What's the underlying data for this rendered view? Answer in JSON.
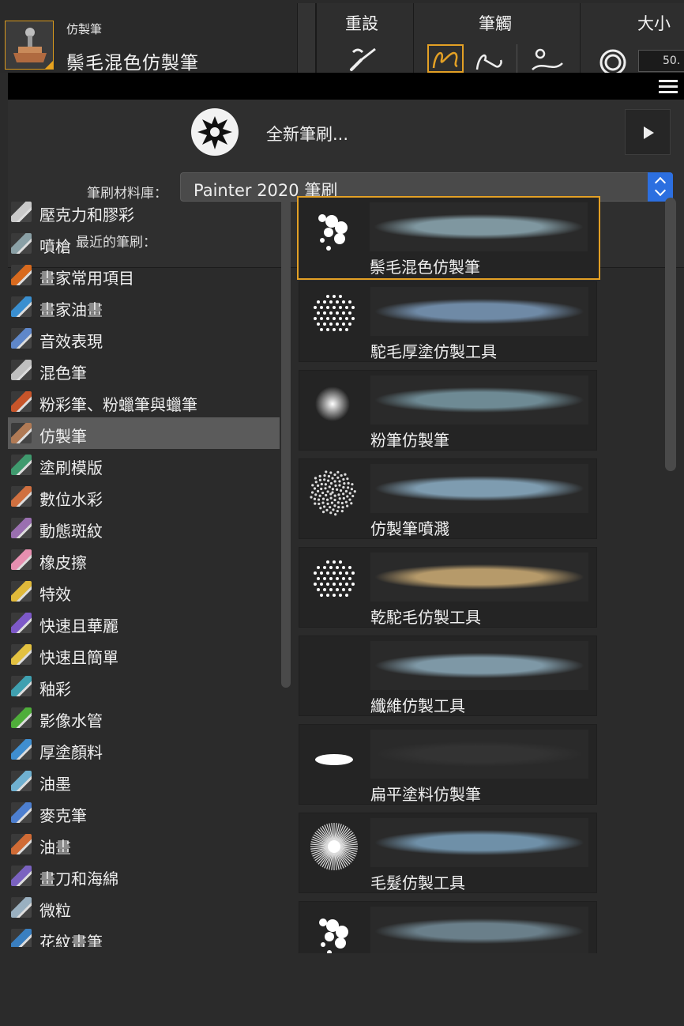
{
  "toolbar": {
    "category": "仿製筆",
    "variant": "鬃毛混色仿製筆",
    "reset_label": "重設",
    "dab_label": "筆觸",
    "size_label": "大小",
    "size_value": "50."
  },
  "panel": {
    "new_brush_label": "全新筆刷...",
    "library_label": "筆刷材料庫：",
    "library_value": "Painter 2020 筆刷",
    "recent_label": "最近的筆刷："
  },
  "categories": [
    {
      "label": "壓克力和膠彩",
      "icon": "acrylic-brush-icon",
      "color": "#c9c9c9"
    },
    {
      "label": "噴槍",
      "icon": "airbrush-icon",
      "color": "#8aa0a6"
    },
    {
      "label": "畫家常用項目",
      "icon": "artist-brush-icon",
      "color": "#d86a1e"
    },
    {
      "label": "畫家油畫",
      "icon": "artist-oil-icon",
      "color": "#3a8fd0"
    },
    {
      "label": "音效表現",
      "icon": "audio-expression-icon",
      "color": "#5f87c9"
    },
    {
      "label": "混色筆",
      "icon": "blender-icon",
      "color": "#bfbfbf"
    },
    {
      "label": "粉彩筆、粉蠟筆與蠟筆",
      "icon": "chalk-crayon-icon",
      "color": "#c8552a"
    },
    {
      "label": "仿製筆",
      "icon": "cloner-stamp-icon",
      "color": "#b07a55",
      "selected": true
    },
    {
      "label": "塗刷模版",
      "icon": "dab-stencil-icon",
      "color": "#3f9a6e"
    },
    {
      "label": "數位水彩",
      "icon": "digital-watercolor-icon",
      "color": "#d07040"
    },
    {
      "label": "動態斑紋",
      "icon": "dynamic-speckle-icon",
      "color": "#9a6fb0"
    },
    {
      "label": "橡皮擦",
      "icon": "eraser-icon",
      "color": "#e78fb0"
    },
    {
      "label": "特效",
      "icon": "effects-star-icon",
      "color": "#e0b93a"
    },
    {
      "label": "快速且華麗",
      "icon": "fast-fancy-icon",
      "color": "#7d59c8"
    },
    {
      "label": "快速且簡單",
      "icon": "fast-easy-icon",
      "color": "#e3c140"
    },
    {
      "label": "釉彩",
      "icon": "glazing-icon",
      "color": "#3fa0b0"
    },
    {
      "label": "影像水管",
      "icon": "image-hose-icon",
      "color": "#4fae3a"
    },
    {
      "label": "厚塗顏料",
      "icon": "impasto-icon",
      "color": "#3f8ed0"
    },
    {
      "label": "油墨",
      "icon": "ink-icon",
      "color": "#6fb0d0"
    },
    {
      "label": "麥克筆",
      "icon": "marker-icon",
      "color": "#4d7fd0"
    },
    {
      "label": "油畫",
      "icon": "oil-brush-icon",
      "color": "#d06b35"
    },
    {
      "label": "畫刀和海綿",
      "icon": "palette-knife-icon",
      "color": "#7a62c0"
    },
    {
      "label": "微粒",
      "icon": "particles-icon",
      "color": "#9ab0c0"
    },
    {
      "label": "花紋畫筆",
      "icon": "pattern-pen-icon",
      "color": "#3a7fc0"
    }
  ],
  "variants": [
    {
      "label": "鬃毛混色仿製筆",
      "selected": true,
      "dab": "dots-large",
      "stroke_color": "#7f97a0"
    },
    {
      "label": "駝毛厚塗仿製工具",
      "dab": "dots-small",
      "stroke_color": "#6f8aa6"
    },
    {
      "label": "粉筆仿製筆",
      "dab": "soft-round",
      "stroke_color": "#6e8a94"
    },
    {
      "label": "仿製筆噴濺",
      "dab": "spatter",
      "stroke_color": "#7e9cb0"
    },
    {
      "label": "乾駝毛仿製工具",
      "dab": "dots-small",
      "stroke_color": "#b69a6a"
    },
    {
      "label": "纖維仿製工具",
      "dab": "blank",
      "stroke_color": "#7e98a6"
    },
    {
      "label": "扁平塗料仿製筆",
      "dab": "flat-ellipse",
      "stroke_color": "#333333"
    },
    {
      "label": "毛髮仿製工具",
      "dab": "hair-burst",
      "stroke_color": "#6f90a8"
    },
    {
      "label": "",
      "dab": "dots-large",
      "stroke_color": "#6a7f8a"
    }
  ],
  "colors": {
    "accent": "#e3a025",
    "selected_row": "#5b5b5b",
    "select_button": "#2c6fe0"
  }
}
